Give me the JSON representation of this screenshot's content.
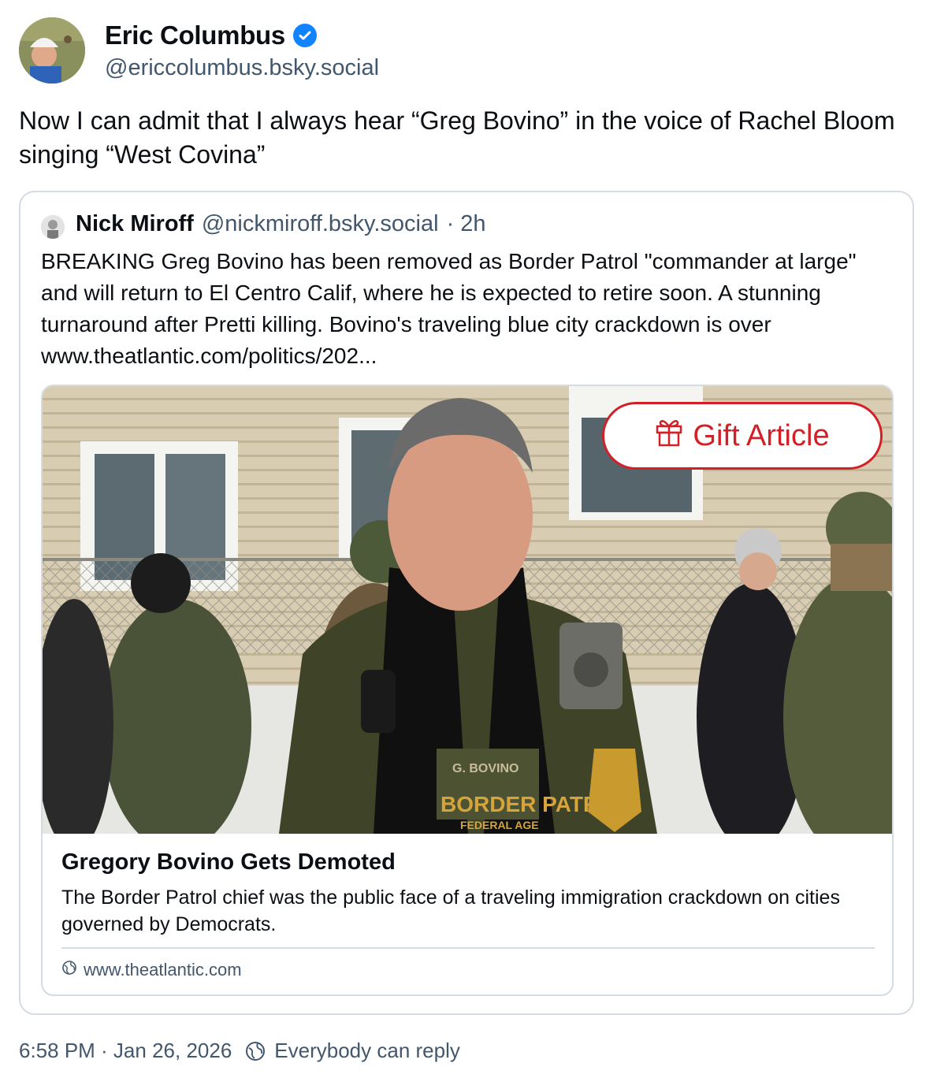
{
  "author": {
    "name": "Eric Columbus",
    "handle": "@ericcolumbus.bsky.social"
  },
  "post_text": "Now I can admit that I always hear “Greg Bovino” in the voice of Rachel Bloom singing “West Covina”",
  "quote": {
    "author_name": "Nick Miroff",
    "author_handle": "@nickmiroff.bsky.social",
    "time": "· 2h",
    "text": "BREAKING Greg Bovino has been removed as Border Patrol \"commander at large\" and will return to El Centro Calif, where he is expected to retire soon. A stunning turnaround after Pretti killing. Bovino's traveling blue city crackdown is over www.theatlantic.com/politics/202...",
    "link": {
      "gift_label": "Gift Article",
      "title": "Gregory Bovino Gets Demoted",
      "description": "The Border Patrol chief was the public face of a traveling immigration crackdown on cities governed by Democrats.",
      "domain": "www.theatlantic.com",
      "photo_texts": [
        "G. BOVINO",
        "BORDER PATR",
        "FEDERAL AGE"
      ]
    }
  },
  "footer": {
    "timestamp": "6:58 PM · Jan 26, 2026",
    "reply_setting": "Everybody can reply"
  },
  "colors": {
    "verified": "#1083fe",
    "secondary_text": "#42576c",
    "border": "#d4dbe2",
    "gift_red": "#d32027"
  }
}
